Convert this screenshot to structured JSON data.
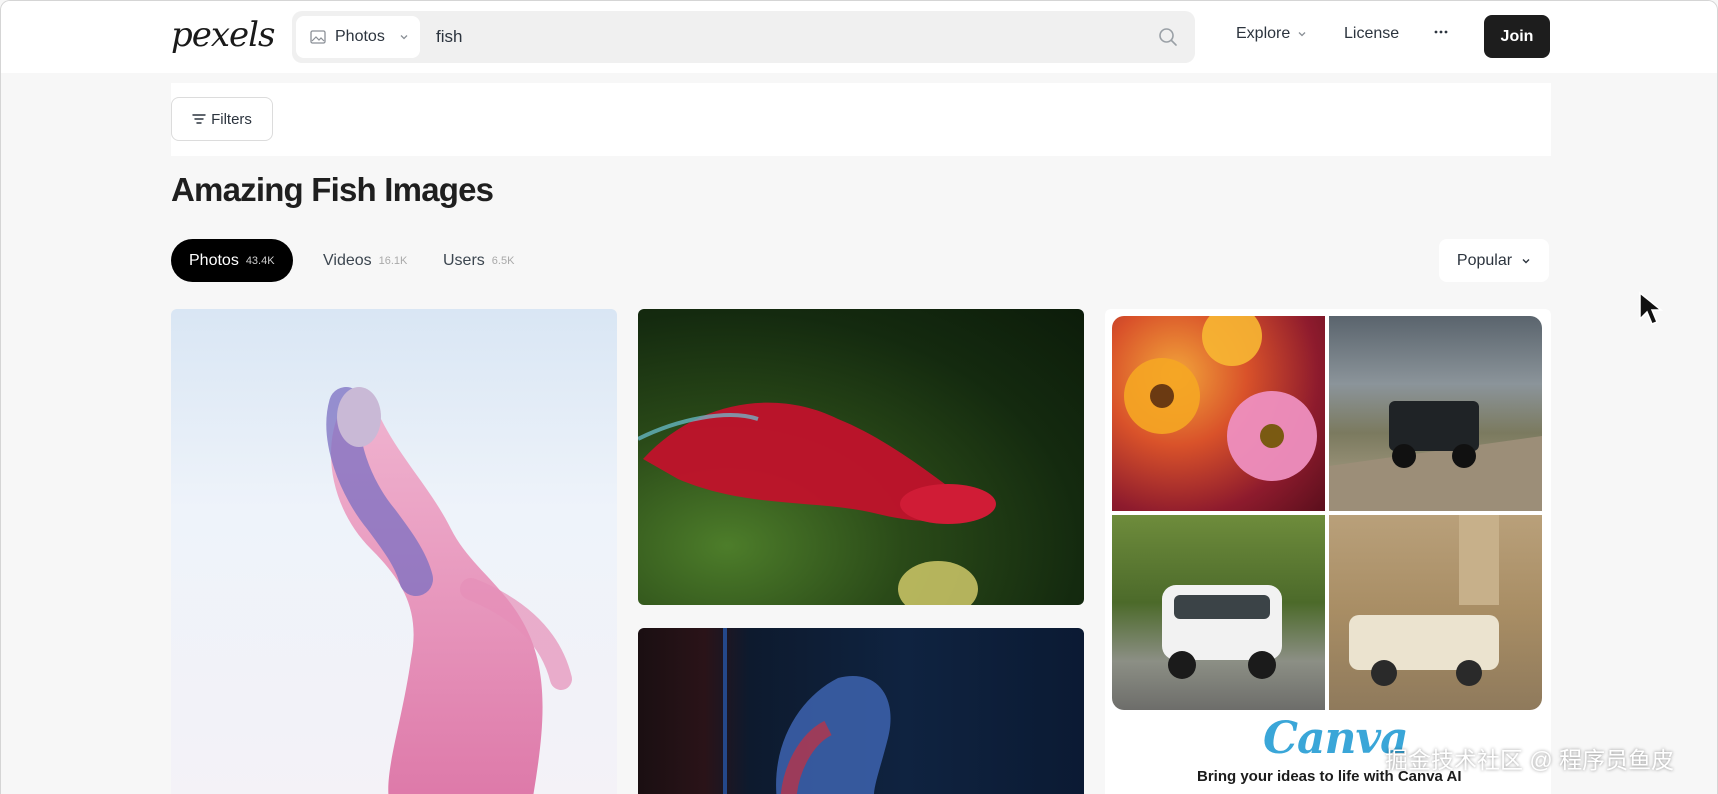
{
  "header": {
    "logo_text": "pexels",
    "search": {
      "type_label": "Photos",
      "query": "fish"
    },
    "nav": {
      "explore_label": "Explore",
      "license_label": "License",
      "more_label": "···",
      "join_label": "Join"
    }
  },
  "filters": {
    "label": "Filters"
  },
  "page_title": "Amazing Fish Images",
  "tabs": [
    {
      "label": "Photos",
      "count": "43.4K",
      "active": true
    },
    {
      "label": "Videos",
      "count": "16.1K",
      "active": false
    },
    {
      "label": "Users",
      "count": "6.5K",
      "active": false
    }
  ],
  "sort": {
    "label": "Popular"
  },
  "ad": {
    "brand": "Canva",
    "tagline": "Bring your ideas to life with Canva AI"
  },
  "watermark": "掘金技术社区 @ 程序员鱼皮",
  "colors": {
    "accent_dark": "#1d1d1d",
    "canva_brand": "#3aa6d8",
    "page_bg": "#f7f7f7"
  }
}
